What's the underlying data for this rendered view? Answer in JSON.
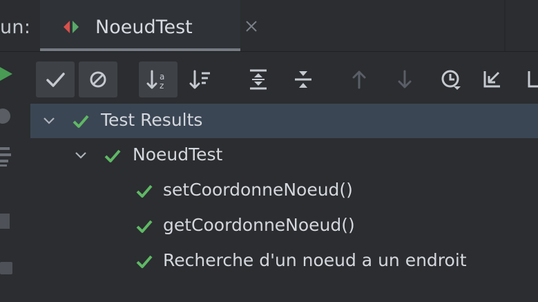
{
  "run_panel": {
    "label": "un:",
    "tab": {
      "title": "NoeudTest"
    }
  },
  "toolbar": {
    "buttons": [
      {
        "icon": "show-passed-icon"
      },
      {
        "icon": "show-ignored-icon"
      },
      {
        "icon": "sort-alphabetically-icon"
      },
      {
        "icon": "sort-by-duration-icon"
      },
      {
        "icon": "expand-all-icon"
      },
      {
        "icon": "collapse-all-icon"
      },
      {
        "icon": "previous-failed-test-icon"
      },
      {
        "icon": "next-failed-test-icon"
      },
      {
        "icon": "test-history-icon"
      },
      {
        "icon": "import-tests-icon"
      },
      {
        "icon": "export-test-results-icon"
      }
    ]
  },
  "tree": {
    "root": {
      "label": "Test Results",
      "status": "passed",
      "expanded": true
    },
    "suite": {
      "label": "NoeudTest",
      "status": "passed",
      "expanded": true
    },
    "tests": [
      {
        "label": "setCoordonneNoeud()",
        "status": "passed"
      },
      {
        "label": "getCoordonneNoeud()",
        "status": "passed"
      },
      {
        "label": "Recherche d'un noeud a un endroit",
        "status": "passed"
      }
    ]
  },
  "colors": {
    "background": "#2b2d30",
    "selection": "#3b4654",
    "passed_green": "#5fb865",
    "run_icon_red": "#d9504a",
    "run_icon_green": "#59a869"
  }
}
